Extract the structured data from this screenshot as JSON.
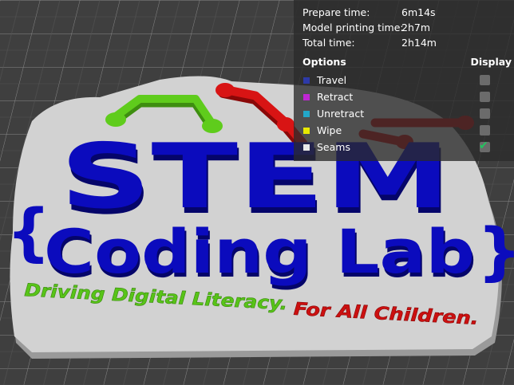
{
  "stats": [
    {
      "label": "Prepare time:",
      "value": "6m14s"
    },
    {
      "label": "Model printing time:",
      "value": "2h7m"
    },
    {
      "label": "Total time:",
      "value": "2h14m"
    }
  ],
  "options_header": {
    "title": "Options",
    "display": "Display"
  },
  "options": [
    {
      "label": "Travel",
      "color": "#2d3aa8",
      "checked": false
    },
    {
      "label": "Retract",
      "color": "#c026d3",
      "checked": false
    },
    {
      "label": "Unretract",
      "color": "#22a7c9",
      "checked": false
    },
    {
      "label": "Wipe",
      "color": "#e8e800",
      "checked": false
    },
    {
      "label": "Seams",
      "color": "#e8e8e8",
      "checked": true
    }
  ],
  "model": {
    "title": "STEM",
    "subtitle": "Coding Lab",
    "brace_left": "{",
    "brace_right": "}",
    "tagline_green": "Driving Digital Literacy.",
    "tagline_red": "For All Children.",
    "colors": {
      "blue": "#0a0ab8",
      "green": "#58c418",
      "red": "#cc1010",
      "base": "#d4d4d4"
    }
  }
}
